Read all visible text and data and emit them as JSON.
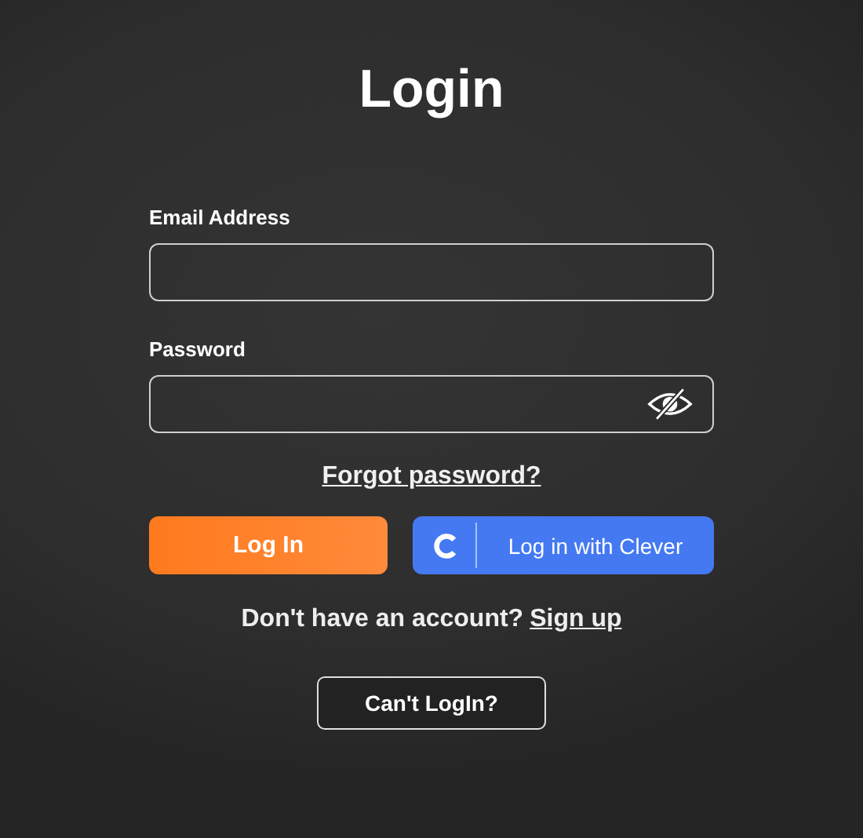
{
  "title": "Login",
  "fields": [
    {
      "label": "Email Address",
      "kind": "text"
    },
    {
      "label": "Password",
      "kind": "password"
    }
  ],
  "forgot_link": "Forgot password?",
  "buttons": [
    {
      "label": "Log In",
      "kind": "primary"
    },
    {
      "label": "Log in with Clever",
      "kind": "clever"
    }
  ],
  "signup": {
    "prompt": "Don't have an account?",
    "link": "Sign up"
  },
  "help_button": "Can't LogIn?"
}
